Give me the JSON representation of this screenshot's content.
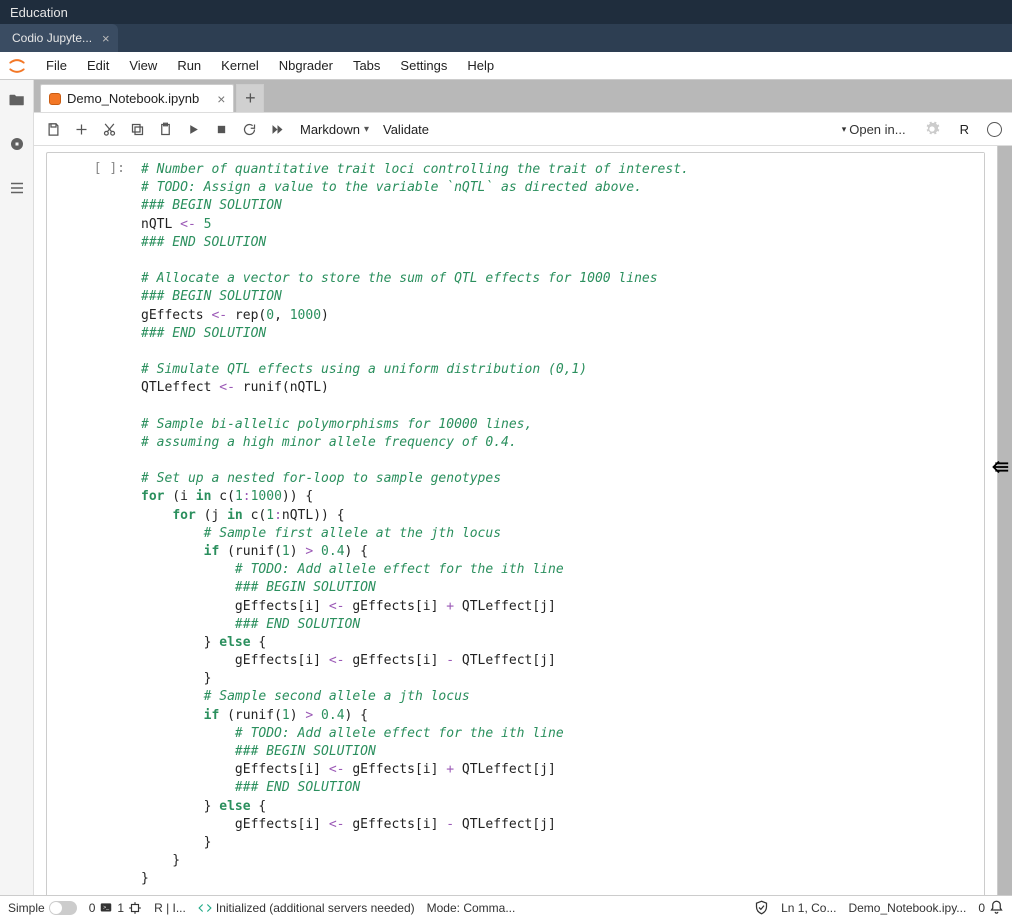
{
  "topbar": {
    "title": "Education"
  },
  "browser_tab": {
    "label": "Codio Jupyte..."
  },
  "menubar": {
    "items": [
      "File",
      "Edit",
      "View",
      "Run",
      "Kernel",
      "Nbgrader",
      "Tabs",
      "Settings",
      "Help"
    ]
  },
  "notebook_tab": {
    "label": "Demo_Notebook.ipynb"
  },
  "toolbar": {
    "celltype": "Markdown",
    "validate": "Validate",
    "open_in": "Open in...",
    "kernel_short": "R"
  },
  "prompt": "[ ]:",
  "code_tokens": [
    [
      [
        "c",
        "# Number of quantitative trait loci controlling the trait of interest."
      ]
    ],
    [
      [
        "c",
        "# TODO: Assign a value to the variable `nQTL` as directed above."
      ]
    ],
    [
      [
        "c",
        "### BEGIN SOLUTION"
      ]
    ],
    [
      [
        "p",
        "nQTL "
      ],
      [
        "o",
        "<-"
      ],
      [
        "p",
        " "
      ],
      [
        "n",
        "5"
      ]
    ],
    [
      [
        "c",
        "### END SOLUTION"
      ]
    ],
    [
      [
        "p",
        ""
      ]
    ],
    [
      [
        "c",
        "# Allocate a vector to store the sum of QTL effects for 1000 lines"
      ]
    ],
    [
      [
        "c",
        "### BEGIN SOLUTION"
      ]
    ],
    [
      [
        "p",
        "gEffects "
      ],
      [
        "o",
        "<-"
      ],
      [
        "p",
        " rep("
      ],
      [
        "n",
        "0"
      ],
      [
        "p",
        ", "
      ],
      [
        "n",
        "1000"
      ],
      [
        "p",
        ")"
      ]
    ],
    [
      [
        "c",
        "### END SOLUTION"
      ]
    ],
    [
      [
        "p",
        ""
      ]
    ],
    [
      [
        "c",
        "# Simulate QTL effects using a uniform distribution (0,1)"
      ]
    ],
    [
      [
        "p",
        "QTLeffect "
      ],
      [
        "o",
        "<-"
      ],
      [
        "p",
        " runif(nQTL)"
      ]
    ],
    [
      [
        "p",
        ""
      ]
    ],
    [
      [
        "c",
        "# Sample bi-allelic polymorphisms for 10000 lines,"
      ]
    ],
    [
      [
        "c",
        "# assuming a high minor allele frequency of 0.4."
      ]
    ],
    [
      [
        "p",
        ""
      ]
    ],
    [
      [
        "c",
        "# Set up a nested for-loop to sample genotypes"
      ]
    ],
    [
      [
        "k",
        "for"
      ],
      [
        "p",
        " (i "
      ],
      [
        "k",
        "in"
      ],
      [
        "p",
        " c("
      ],
      [
        "n",
        "1"
      ],
      [
        "o",
        ":"
      ],
      [
        "n",
        "1000"
      ],
      [
        "p",
        ")) {"
      ]
    ],
    [
      [
        "p",
        "    "
      ],
      [
        "k",
        "for"
      ],
      [
        "p",
        " (j "
      ],
      [
        "k",
        "in"
      ],
      [
        "p",
        " c("
      ],
      [
        "n",
        "1"
      ],
      [
        "o",
        ":"
      ],
      [
        "p",
        "nQTL)) {"
      ]
    ],
    [
      [
        "p",
        "        "
      ],
      [
        "c",
        "# Sample first allele at the jth locus"
      ]
    ],
    [
      [
        "p",
        "        "
      ],
      [
        "k",
        "if"
      ],
      [
        "p",
        " (runif("
      ],
      [
        "n",
        "1"
      ],
      [
        "p",
        ") "
      ],
      [
        "o",
        ">"
      ],
      [
        "p",
        " "
      ],
      [
        "n",
        "0.4"
      ],
      [
        "p",
        ") {"
      ]
    ],
    [
      [
        "p",
        "            "
      ],
      [
        "c",
        "# TODO: Add allele effect for the ith line"
      ]
    ],
    [
      [
        "p",
        "            "
      ],
      [
        "c",
        "### BEGIN SOLUTION"
      ]
    ],
    [
      [
        "p",
        "            gEffects[i] "
      ],
      [
        "o",
        "<-"
      ],
      [
        "p",
        " gEffects[i] "
      ],
      [
        "o",
        "+"
      ],
      [
        "p",
        " QTLeffect[j]"
      ]
    ],
    [
      [
        "p",
        "            "
      ],
      [
        "c",
        "### END SOLUTION"
      ]
    ],
    [
      [
        "p",
        "        } "
      ],
      [
        "k",
        "else"
      ],
      [
        "p",
        " {"
      ]
    ],
    [
      [
        "p",
        "            gEffects[i] "
      ],
      [
        "o",
        "<-"
      ],
      [
        "p",
        " gEffects[i] "
      ],
      [
        "o",
        "-"
      ],
      [
        "p",
        " QTLeffect[j]"
      ]
    ],
    [
      [
        "p",
        "        }"
      ]
    ],
    [
      [
        "p",
        "        "
      ],
      [
        "c",
        "# Sample second allele a jth locus"
      ]
    ],
    [
      [
        "p",
        "        "
      ],
      [
        "k",
        "if"
      ],
      [
        "p",
        " (runif("
      ],
      [
        "n",
        "1"
      ],
      [
        "p",
        ") "
      ],
      [
        "o",
        ">"
      ],
      [
        "p",
        " "
      ],
      [
        "n",
        "0.4"
      ],
      [
        "p",
        ") {"
      ]
    ],
    [
      [
        "p",
        "            "
      ],
      [
        "c",
        "# TODO: Add allele effect for the ith line"
      ]
    ],
    [
      [
        "p",
        "            "
      ],
      [
        "c",
        "### BEGIN SOLUTION"
      ]
    ],
    [
      [
        "p",
        "            gEffects[i] "
      ],
      [
        "o",
        "<-"
      ],
      [
        "p",
        " gEffects[i] "
      ],
      [
        "o",
        "+"
      ],
      [
        "p",
        " QTLeffect[j]"
      ]
    ],
    [
      [
        "p",
        "            "
      ],
      [
        "c",
        "### END SOLUTION"
      ]
    ],
    [
      [
        "p",
        "        } "
      ],
      [
        "k",
        "else"
      ],
      [
        "p",
        " {"
      ]
    ],
    [
      [
        "p",
        "            gEffects[i] "
      ],
      [
        "o",
        "<-"
      ],
      [
        "p",
        " gEffects[i] "
      ],
      [
        "o",
        "-"
      ],
      [
        "p",
        " QTLeffect[j]"
      ]
    ],
    [
      [
        "p",
        "        }"
      ]
    ],
    [
      [
        "p",
        "    }"
      ]
    ],
    [
      [
        "p",
        "}"
      ]
    ]
  ],
  "status": {
    "simple": "Simple",
    "count0a": "0",
    "terminals": "1",
    "kernel_lang": "R | I...",
    "init": "Initialized (additional servers needed)",
    "mode": "Mode: Comma...",
    "ln": "Ln 1, Co...",
    "filename": "Demo_Notebook.ipy...",
    "count0b": "0"
  }
}
